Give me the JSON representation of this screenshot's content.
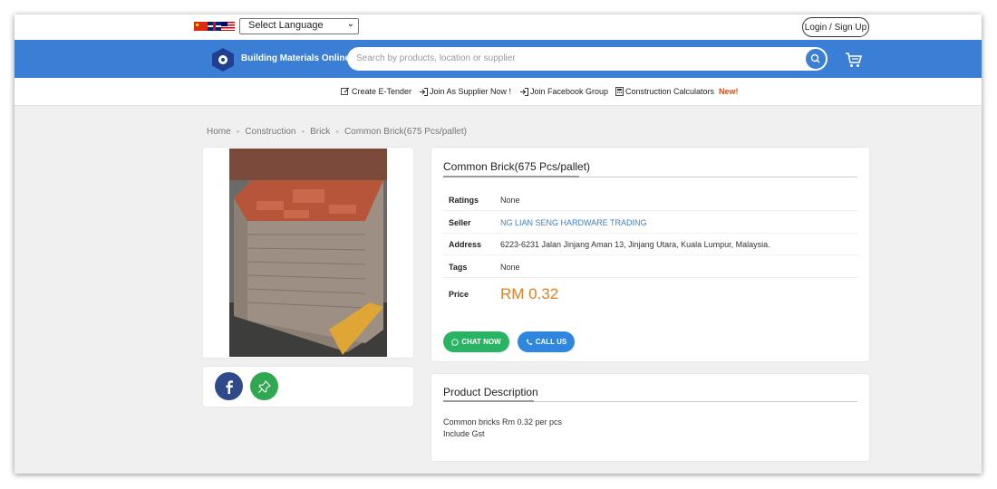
{
  "topbar": {
    "language_select": "Select Language",
    "login": "Login / Sign Up",
    "flags": [
      "cn-flag-icon",
      "uk-flag-icon",
      "my-flag-icon"
    ]
  },
  "navbar": {
    "brand": "Building Materials Online",
    "search_placeholder": "Search by products, location or supplier",
    "accent": "#3a7fd5"
  },
  "links": {
    "tender": "Create E-Tender",
    "supplier": "Join As Supplier Now !",
    "facebook": "Join Facebook Group",
    "calculators": "Construction Calculators",
    "new_badge": "New!"
  },
  "breadcrumb": [
    "Home",
    "Construction",
    "Brick",
    "Common Brick(675 Pcs/pallet)"
  ],
  "product": {
    "title": "Common Brick(675 Pcs/pallet)",
    "rows": [
      {
        "label": "Ratings",
        "value": "None"
      },
      {
        "label": "Seller",
        "value": "NG LIAN SENG HARDWARE TRADING"
      },
      {
        "label": "Address",
        "value": "6223-6231 Jalan Jinjang Aman 13, Jinjang Utara, Kuala Lumpur, Malaysia."
      },
      {
        "label": "Tags",
        "value": "None"
      }
    ],
    "price_label": "Price",
    "price": "RM 0.32",
    "price_color": "#e67e22",
    "chat_button": "CHAT NOW",
    "call_button": "CALL US"
  },
  "description": {
    "title": "Product Description",
    "lines": [
      "Common bricks Rm 0.32 per pcs",
      "Include Gst"
    ]
  }
}
